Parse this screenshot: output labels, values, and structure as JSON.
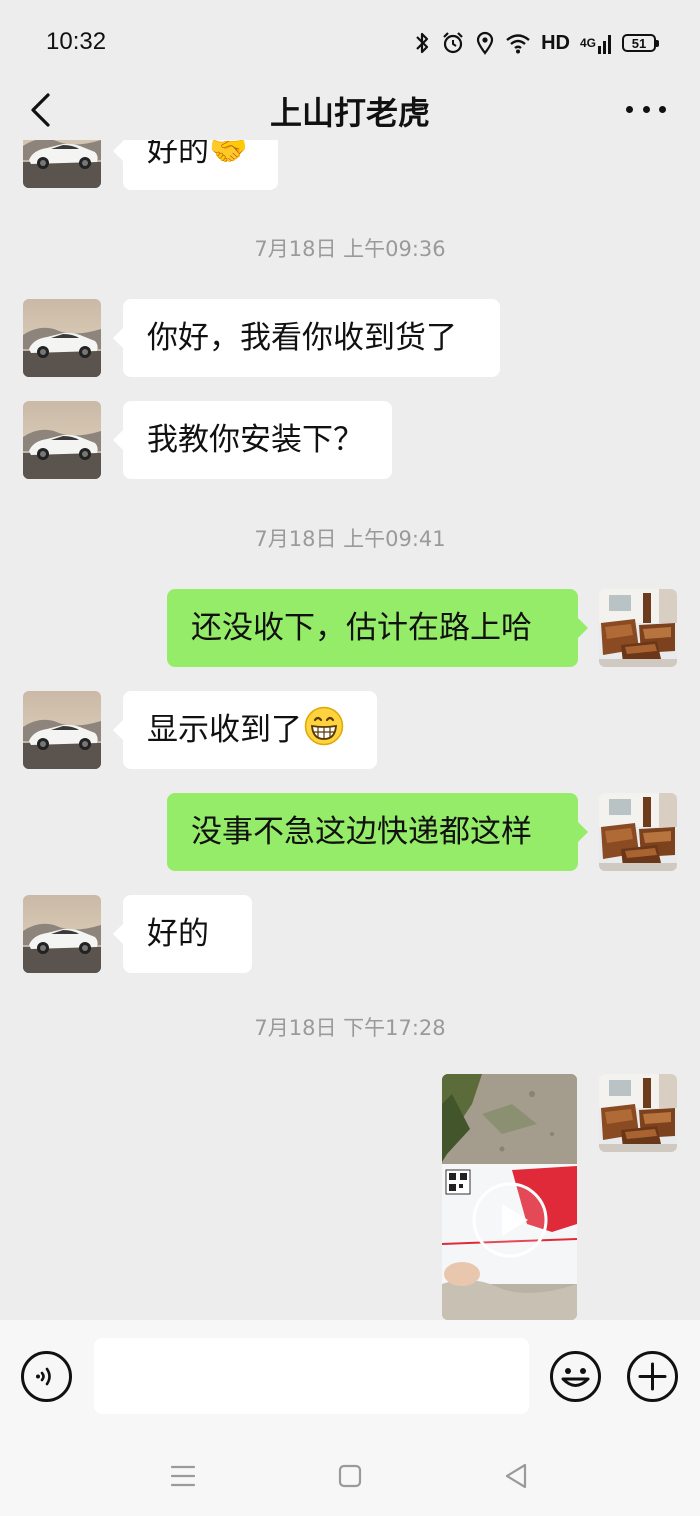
{
  "status_bar": {
    "time": "10:32",
    "network": "4G",
    "hd_label": "HD",
    "battery": "51",
    "icons": [
      "bluetooth-icon",
      "alarm-icon",
      "location-icon",
      "wifi-icon",
      "signal-icon",
      "battery-icon"
    ]
  },
  "header": {
    "title": "上山打老虎",
    "back_icon": "chevron-left-icon",
    "more_icon": "more-dots-icon"
  },
  "messages": {
    "partial_top": {
      "text": "好的🤝",
      "sender": "contact"
    },
    "ts1": "7月18日 上午09:36",
    "m1": "你好，我看你收到货了",
    "m2": "我教你安装下？",
    "ts2": "7月18日 上午09:41",
    "m3": "还没收下，估计在路上哈",
    "m4": "显示收到了",
    "m5": "没事不急这边快递都这样",
    "m6": "好的",
    "ts3": "7月18日 下午17:28",
    "video": {
      "type": "video",
      "icon": "play-icon"
    }
  },
  "input_bar": {
    "placeholder": "",
    "voice_icon": "voice-icon",
    "emoji_icon": "emoji-icon",
    "plus_icon": "plus-icon"
  },
  "nav_bar": {
    "icons": [
      "menu-icon",
      "home-square-icon",
      "back-triangle-icon"
    ]
  },
  "colors": {
    "background": "#ededed",
    "outgoing_bubble": "#95ec69",
    "incoming_bubble": "#ffffff",
    "timestamp": "#9a9a9a"
  }
}
